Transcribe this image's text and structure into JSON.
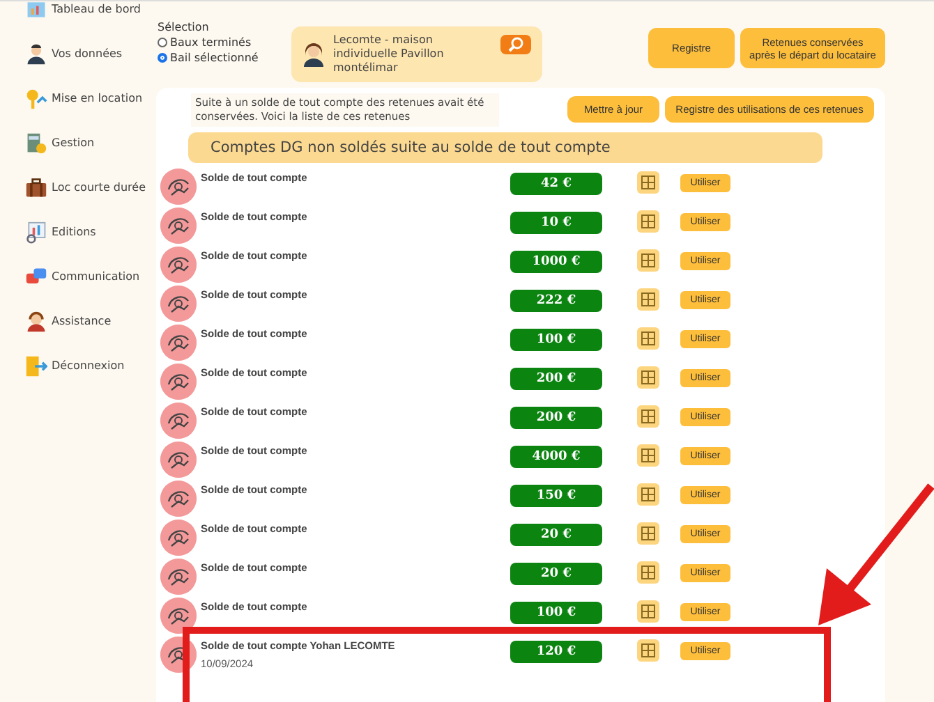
{
  "sidebar": {
    "items": [
      {
        "label": "Tableau de bord"
      },
      {
        "label": "Vos données"
      },
      {
        "label": "Mise en location"
      },
      {
        "label": "Gestion"
      },
      {
        "label": "Loc courte durée"
      },
      {
        "label": "Editions"
      },
      {
        "label": "Communication"
      },
      {
        "label": "Assistance"
      },
      {
        "label": "Déconnexion"
      }
    ]
  },
  "selection": {
    "title": "Sélection",
    "options": [
      {
        "label": "Baux terminés",
        "selected": false
      },
      {
        "label": "Bail sélectionné",
        "selected": true
      }
    ]
  },
  "lease_card": {
    "text": "Lecomte - maison individuelle Pavillon montélimar"
  },
  "top_buttons": [
    "Registre",
    "Retenues conservées après le départ du locataire"
  ],
  "notice": "Suite à un solde de tout compte des retenues avait été conservées. Voici la liste de ces retenues",
  "panel_buttons": [
    "Mettre à jour",
    "Registre des utilisations de ces retenues"
  ],
  "section_title": "Comptes DG non soldés suite au solde de tout compte",
  "rows": [
    {
      "title": "Solde de tout compte",
      "amount": "42 €",
      "action": "Utiliser"
    },
    {
      "title": "Solde de tout compte",
      "amount": "10 €",
      "action": "Utiliser"
    },
    {
      "title": "Solde de tout compte",
      "amount": "1000 €",
      "action": "Utiliser"
    },
    {
      "title": "Solde de tout compte",
      "amount": "222 €",
      "action": "Utiliser"
    },
    {
      "title": "Solde de tout compte",
      "amount": "100 €",
      "action": "Utiliser"
    },
    {
      "title": "Solde de tout compte",
      "amount": "200 €",
      "action": "Utiliser"
    },
    {
      "title": "Solde de tout compte",
      "amount": "200 €",
      "action": "Utiliser"
    },
    {
      "title": "Solde de tout compte",
      "amount": "4000 €",
      "action": "Utiliser"
    },
    {
      "title": "Solde de tout compte",
      "amount": "150 €",
      "action": "Utiliser"
    },
    {
      "title": "Solde de tout compte",
      "amount": "20 €",
      "action": "Utiliser"
    },
    {
      "title": "Solde de tout compte",
      "amount": "20 €",
      "action": "Utiliser"
    },
    {
      "title": "Solde de tout compte",
      "amount": "100 €",
      "action": "Utiliser"
    },
    {
      "title": "Solde de tout compte Yohan LECOMTE",
      "date": "10/09/2024",
      "amount": "120 €",
      "action": "Utiliser",
      "highlighted": true
    }
  ]
}
